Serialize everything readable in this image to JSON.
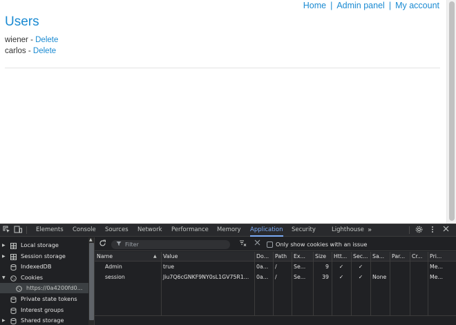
{
  "page": {
    "nav": {
      "home": "Home",
      "admin_panel": "Admin panel",
      "my_account": "My account",
      "separator": "|"
    },
    "title": "Users",
    "users": [
      {
        "name": "wiener",
        "separator": " - ",
        "action": "Delete"
      },
      {
        "name": "carlos",
        "separator": " - ",
        "action": "Delete"
      }
    ]
  },
  "devtools": {
    "tabs": [
      "Elements",
      "Console",
      "Sources",
      "Network",
      "Performance",
      "Memory",
      "Application",
      "Security",
      "Lighthouse"
    ],
    "active_tab": "Application",
    "more_tabs_glyph": "»",
    "sidebar": {
      "items": [
        {
          "label": "Local storage",
          "icon": "table-icon",
          "expandable": true
        },
        {
          "label": "Session storage",
          "icon": "table-icon",
          "expandable": true
        },
        {
          "label": "IndexedDB",
          "icon": "database-icon",
          "expandable": false
        },
        {
          "label": "Cookies",
          "icon": "cookie-icon",
          "expandable": true,
          "expanded": true
        },
        {
          "label": "https://0a4200fd0...",
          "icon": "cookie-icon",
          "child": true,
          "selected": true
        },
        {
          "label": "Private state tokens",
          "icon": "database-icon",
          "expandable": false
        },
        {
          "label": "Interest groups",
          "icon": "database-icon",
          "expandable": false
        },
        {
          "label": "Shared storage",
          "icon": "database-icon",
          "expandable": true
        }
      ]
    },
    "toolbar": {
      "filter_placeholder": "Filter",
      "only_issue_label": "Only show cookies with an issue"
    },
    "cookies_table": {
      "columns": [
        "Name",
        "Value",
        "Do...",
        "Path",
        "Ex...",
        "Size",
        "Htt...",
        "Sec...",
        "Sa...",
        "Par...",
        "Cr...",
        "Pri..."
      ],
      "sort_indicator": "▲",
      "rows": [
        {
          "name": "Admin",
          "value": "true",
          "domain": "0a...",
          "path": "/",
          "expires": "Se...",
          "size": "9",
          "httponly": "✓",
          "secure": "✓",
          "samesite": "",
          "partition": "",
          "cross_site": "",
          "priority": "Me..."
        },
        {
          "name": "session",
          "value": "Jiu7Q6cGNKF9NY0sL1GV75R1...",
          "domain": "0a...",
          "path": "/",
          "expires": "Se...",
          "size": "39",
          "httponly": "✓",
          "secure": "✓",
          "samesite": "None",
          "partition": "",
          "cross_site": "",
          "priority": "Me..."
        }
      ]
    },
    "colors": {
      "accent": "#7cacf8",
      "background": "#202124",
      "link": "#1a8ad2"
    }
  }
}
